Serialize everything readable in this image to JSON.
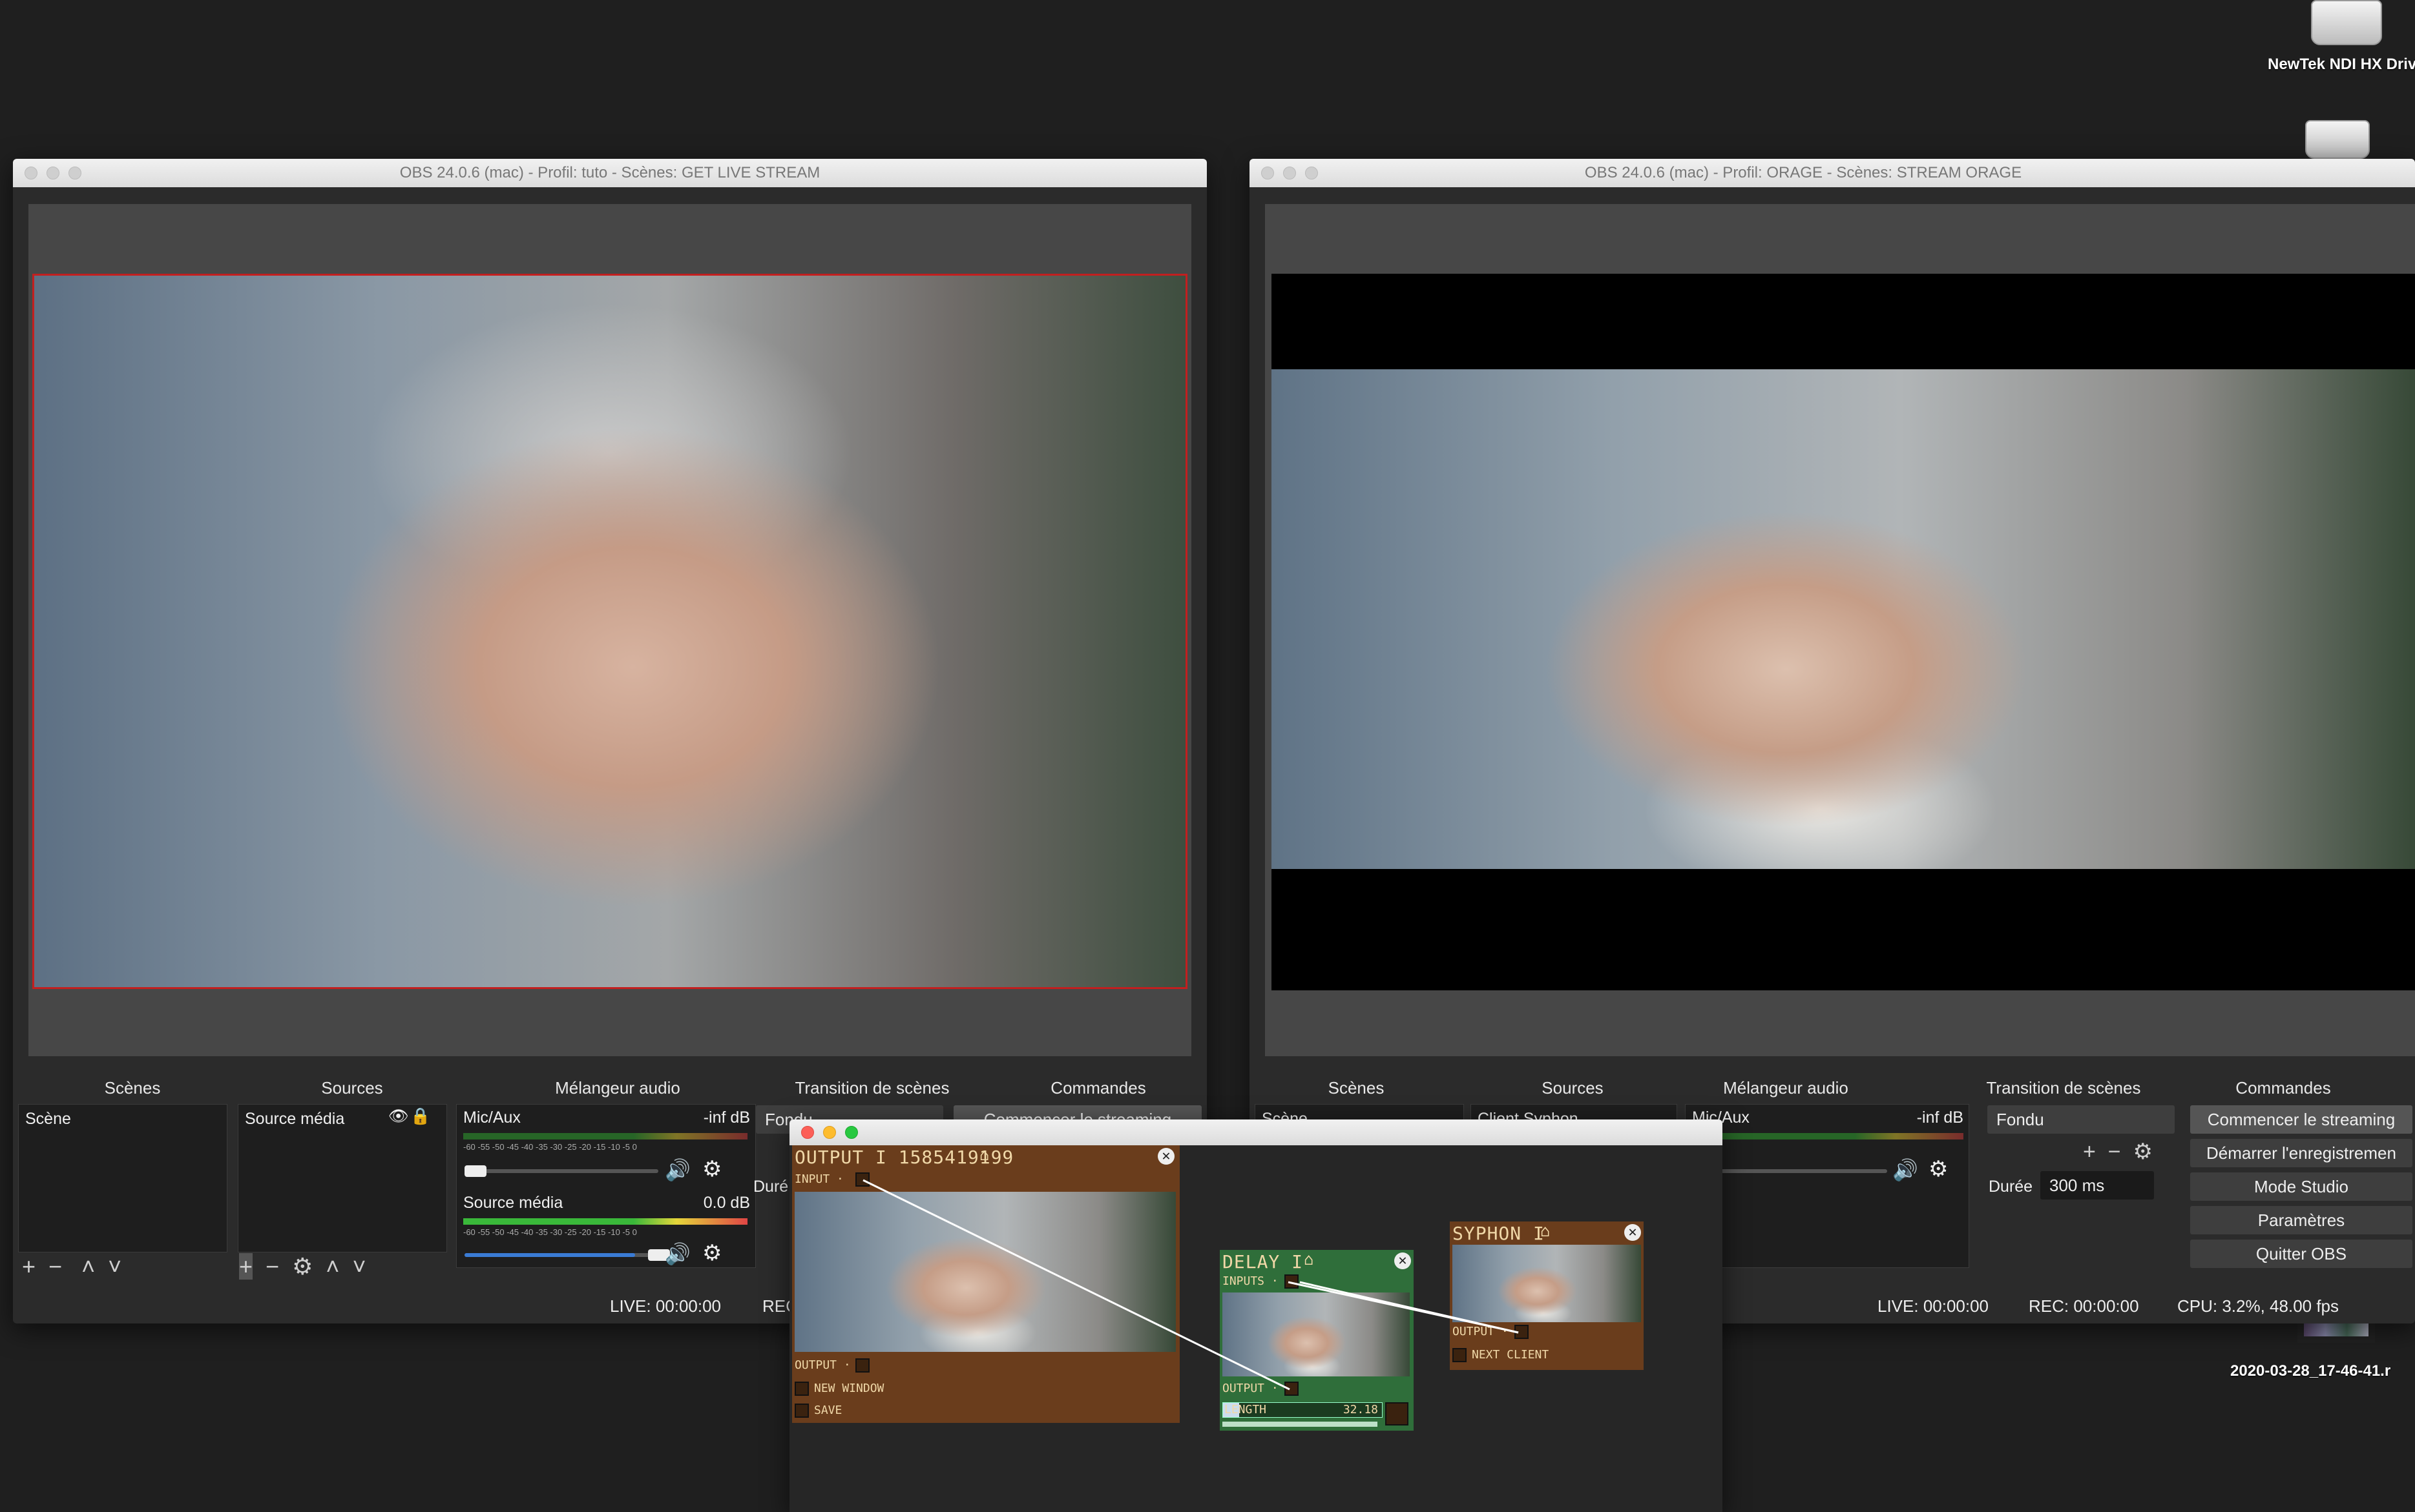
{
  "desktop": {
    "drive_label": "NewTek NDI HX Drive",
    "file_label": "2020-03-28_17-46-41.r"
  },
  "obs_left": {
    "title": "OBS 24.0.6 (mac) - Profil: tuto - Scènes: GET LIVE STREAM",
    "docks": {
      "scenes": "Scènes",
      "sources": "Sources",
      "mixer": "Mélangeur audio",
      "transitions": "Transition de scènes",
      "controls": "Commandes"
    },
    "scene_item": "Scène",
    "source_item": "Source média",
    "mixer": [
      {
        "name": "Mic/Aux",
        "level": "-inf dB"
      },
      {
        "name": "Source média",
        "level": "0.0 dB"
      }
    ],
    "meter_ticks": "-60 -55 -50 -45 -40 -35 -30 -25 -20 -15 -10 -5 0",
    "transition": "Fondu",
    "duration_label": "Duré",
    "start_stream": "Commencer le streaming",
    "live": "LIVE: 00:00:00",
    "rec": "REC"
  },
  "obs_right": {
    "title": "OBS 24.0.6 (mac) - Profil: ORAGE - Scènes: STREAM ORAGE",
    "docks": {
      "scenes": "Scènes",
      "sources": "Sources",
      "mixer": "Mélangeur audio",
      "transitions": "Transition de scènes",
      "controls": "Commandes"
    },
    "scene_item": "Scène",
    "source_item": "Client Syphon",
    "mixer": [
      {
        "name": "Mic/Aux",
        "level": "-inf dB"
      }
    ],
    "transition": "Fondu",
    "duration_label": "Durée",
    "duration_value": "300 ms",
    "buttons": [
      "Commencer le streaming",
      "Démarrer l'enregistremen",
      "Mode Studio",
      "Paramètres",
      "Quitter OBS"
    ],
    "live": "LIVE: 00:00:00",
    "rec": "REC: 00:00:00",
    "cpu": "CPU: 3.2%, 48.00 fps"
  },
  "patch": {
    "output_node": {
      "title": "OUTPUT I 1585419199",
      "input": "INPUT ·",
      "output": "OUTPUT ·",
      "new_window": "NEW WINDOW",
      "save": "SAVE"
    },
    "delay_node": {
      "title": "DELAY I",
      "inputs": "INPUTS ·",
      "output": "OUTPUT ·",
      "length_label": "LENGTH",
      "length_value": "32.18",
      "length_fraction": 0.1
    },
    "syphon_node": {
      "title": "SYPHON I",
      "output": "OUTPUT ·",
      "next_client": "NEXT CLIENT"
    },
    "colors": {
      "brown": "#6a3d1c",
      "green": "#2f6e3a"
    }
  }
}
